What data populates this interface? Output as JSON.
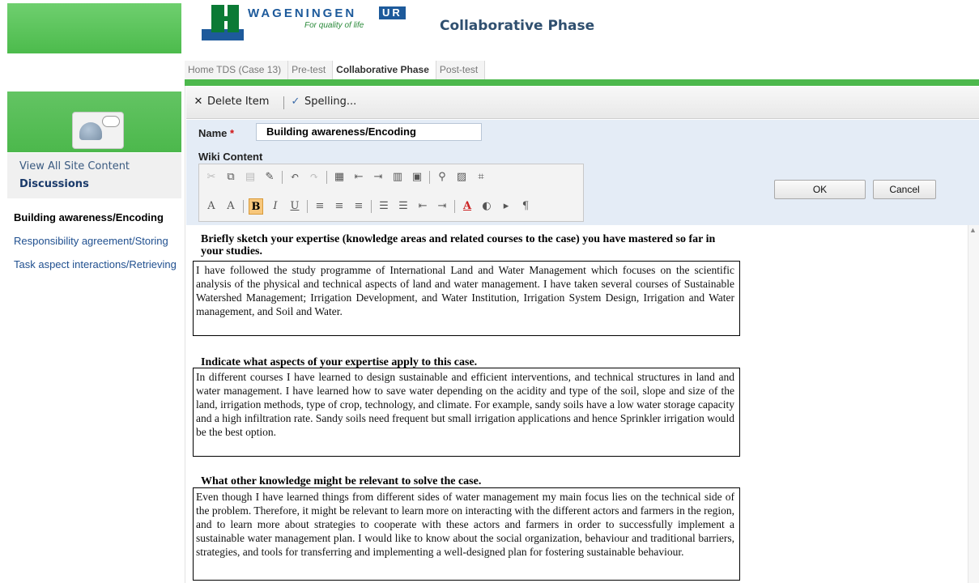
{
  "header": {
    "brand": "WAGENINGEN",
    "brand_badge": "UR",
    "tagline": "For quality of life",
    "site_title": "Collaborative Phase"
  },
  "tabs": [
    {
      "label": "Home TDS (Case 13)",
      "active": false
    },
    {
      "label": "Pre-test",
      "active": false
    },
    {
      "label": "Collaborative Phase",
      "active": true
    },
    {
      "label": "Post-test",
      "active": false
    }
  ],
  "left_nav": {
    "view_all": "View All Site Content",
    "discussions": "Discussions",
    "quick_links": [
      "Building awareness/Encoding",
      "Responsibility agreement/Storing",
      "Task aspect interactions/Retrieving"
    ]
  },
  "toolbar": {
    "delete_label": "Delete Item",
    "spelling_label": "Spelling..."
  },
  "form": {
    "name_label": "Name",
    "required_mark": "*",
    "name_value": "Building awareness/Encoding",
    "wiki_label": "Wiki Content",
    "ok_label": "OK",
    "cancel_label": "Cancel"
  },
  "rte": {
    "row1_icons": [
      "cut-icon",
      "copy-icon",
      "paste-icon",
      "format-painter-icon",
      "undo-icon",
      "redo-icon",
      "insert-table-icon",
      "insert-column-left-icon",
      "insert-column-right-icon",
      "table-grid-icon",
      "table-properties-icon",
      "insert-link-icon",
      "insert-image-icon",
      "html-source-icon"
    ],
    "row2_labels": [
      "A",
      "A",
      "B",
      "I",
      "U"
    ],
    "accent": "#f7c77c"
  },
  "content": {
    "q1": "Briefly sketch your expertise (knowledge areas and related courses to the case) you have mastered so far in your studies.",
    "a1": "I have followed the study programme of International Land and Water Management which focuses on the scientific analysis of the physical and technical aspects of land and water management. I have taken several courses of Sustainable Watershed Management; Irrigation Development, and Water Institution, Irrigation System Design, Irrigation and Water management,  and Soil and Water.",
    "q2": "Indicate what aspects of your expertise apply to this case.",
    "a2": "In different courses I have learned to design sustainable and efficient interventions, and technical structures in land and water management. I have learned how to save water depending on the acidity and type of the soil, slope and size of the land,  irrigation methods, type of crop, technology, and climate. For example, sandy soils have a low water storage capacity and a high infiltration rate. Sandy soils need frequent but small irrigation applications and hence Sprinkler irrigation would be the best option.",
    "q3": "What other knowledge might be relevant to solve the case.",
    "a3": "Even though I have learned things from different sides of water management my main focus lies on the technical side of the problem. Therefore, it might be relevant to learn more on interacting with the different actors and farmers in the region, and to learn more about strategies to cooperate with these actors and farmers in order to successfully implement a sustainable water management plan. I would like to know about the social organization, behaviour and traditional barriers, strategies, and tools for transferring and implementing a well-designed plan for fostering sustainable behaviour."
  },
  "colors": {
    "green": "#4cb84c",
    "brand_blue": "#1d5a9b",
    "edit_bg": "#e4ecf6"
  }
}
